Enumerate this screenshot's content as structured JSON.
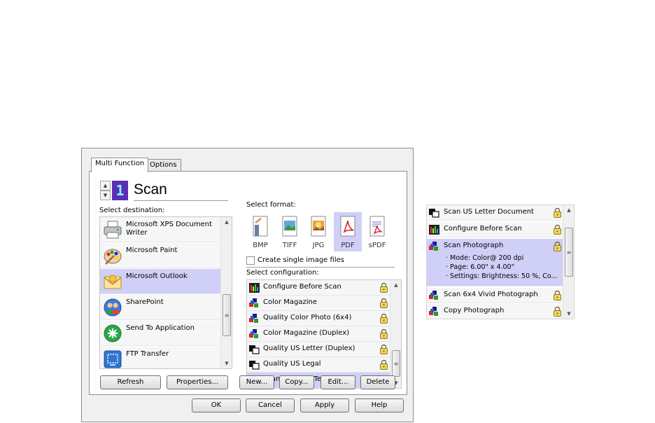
{
  "tabs": [
    {
      "label": "Multi Function",
      "active": true
    },
    {
      "label": "Options",
      "active": false
    }
  ],
  "header": {
    "counter": "1",
    "title": "Scan"
  },
  "destination": {
    "label": "Select destination:",
    "items": [
      {
        "label": "Microsoft XPS Document Writer",
        "icon": "printer-icon",
        "selected": false
      },
      {
        "label": "Microsoft Paint",
        "icon": "paint-palette-icon",
        "selected": false
      },
      {
        "label": "Microsoft Outlook",
        "icon": "outlook-icon",
        "selected": true
      },
      {
        "label": "SharePoint",
        "icon": "sharepoint-icon",
        "selected": false
      },
      {
        "label": "Send To Application",
        "icon": "send-to-application-icon",
        "selected": false
      },
      {
        "label": "FTP Transfer",
        "icon": "ftp-transfer-icon",
        "selected": false
      }
    ],
    "refresh_label": "Refresh",
    "properties_label": "Properties..."
  },
  "format": {
    "label": "Select format:",
    "items": [
      {
        "label": "BMP",
        "selected": false
      },
      {
        "label": "TIFF",
        "selected": false
      },
      {
        "label": "JPG",
        "selected": false
      },
      {
        "label": "PDF",
        "selected": true
      },
      {
        "label": "sPDF",
        "selected": false
      }
    ],
    "single_image_label": "Create single image files",
    "single_image_checked": false
  },
  "configuration": {
    "label": "Select configuration:",
    "items": [
      {
        "label": "Configure Before Scan",
        "icon": "configure-icon",
        "locked": true,
        "selected": false
      },
      {
        "label": "Color Magazine",
        "icon": "color-scan-icon",
        "locked": true,
        "selected": false
      },
      {
        "label": "Quality Color Photo (6x4)",
        "icon": "color-scan-icon",
        "locked": true,
        "selected": false
      },
      {
        "label": "Color Magazine (Duplex)",
        "icon": "color-scan-icon",
        "locked": true,
        "selected": false
      },
      {
        "label": "Quality US Letter (Duplex)",
        "icon": "bw-scan-icon",
        "locked": true,
        "selected": false
      },
      {
        "label": "Quality US Legal",
        "icon": "bw-scan-icon",
        "locked": true,
        "selected": false
      },
      {
        "label": "Scan for Light Text",
        "icon": "bw-scan-icon",
        "locked": false,
        "selected": true
      }
    ],
    "new_label": "New...",
    "copy_label": "Copy...",
    "edit_label": "Edit...",
    "delete_label": "Delete"
  },
  "footer": {
    "ok": "OK",
    "cancel": "Cancel",
    "apply": "Apply",
    "help": "Help"
  },
  "side_panel": {
    "items": [
      {
        "label": "Scan US Letter Document",
        "icon": "bw-scan-icon",
        "locked": true
      },
      {
        "label": "Configure Before Scan",
        "icon": "configure-icon",
        "locked": true
      },
      {
        "label": "Scan Photograph",
        "icon": "color-scan-icon",
        "locked": true,
        "selected": true,
        "details": [
          "· Mode: Color@ 200 dpi",
          "· Page:  6.00\" x  4.00\"",
          "· Settings: Brightness: 50 %, Co..."
        ]
      },
      {
        "label": "Scan 6x4 Vivid Photograph",
        "icon": "color-scan-icon",
        "locked": true
      },
      {
        "label": "Copy Photograph",
        "icon": "color-scan-icon",
        "locked": true
      }
    ]
  },
  "colors": {
    "selection": "#cfcff7",
    "counter_bg": "#5b2fb5",
    "counter_fg": "#7cf5ff"
  }
}
